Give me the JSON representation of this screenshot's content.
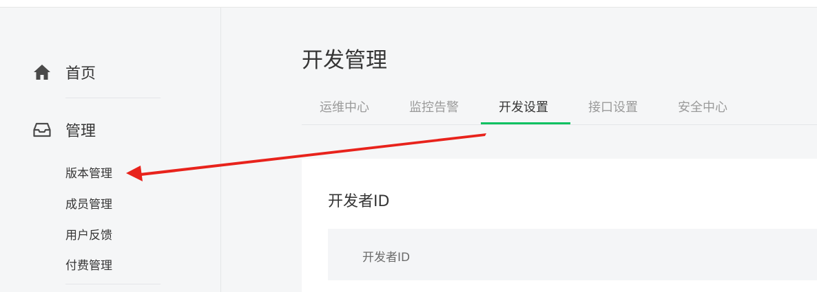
{
  "sidebar": {
    "home": {
      "label": "首页",
      "icon": "home-icon"
    },
    "manage": {
      "label": "管理",
      "icon": "inbox-icon"
    },
    "sub_items": [
      "版本管理",
      "成员管理",
      "用户反馈",
      "付费管理"
    ]
  },
  "main": {
    "title": "开发管理",
    "tabs": [
      "运维中心",
      "监控告警",
      "开发设置",
      "接口设置",
      "安全中心"
    ],
    "active_tab": "开发设置",
    "section": {
      "title": "开发者ID",
      "field_label": "开发者ID"
    }
  },
  "colors": {
    "accent": "#07c160",
    "annotation_arrow": "#e8231c",
    "background": "#f5f6f7"
  }
}
